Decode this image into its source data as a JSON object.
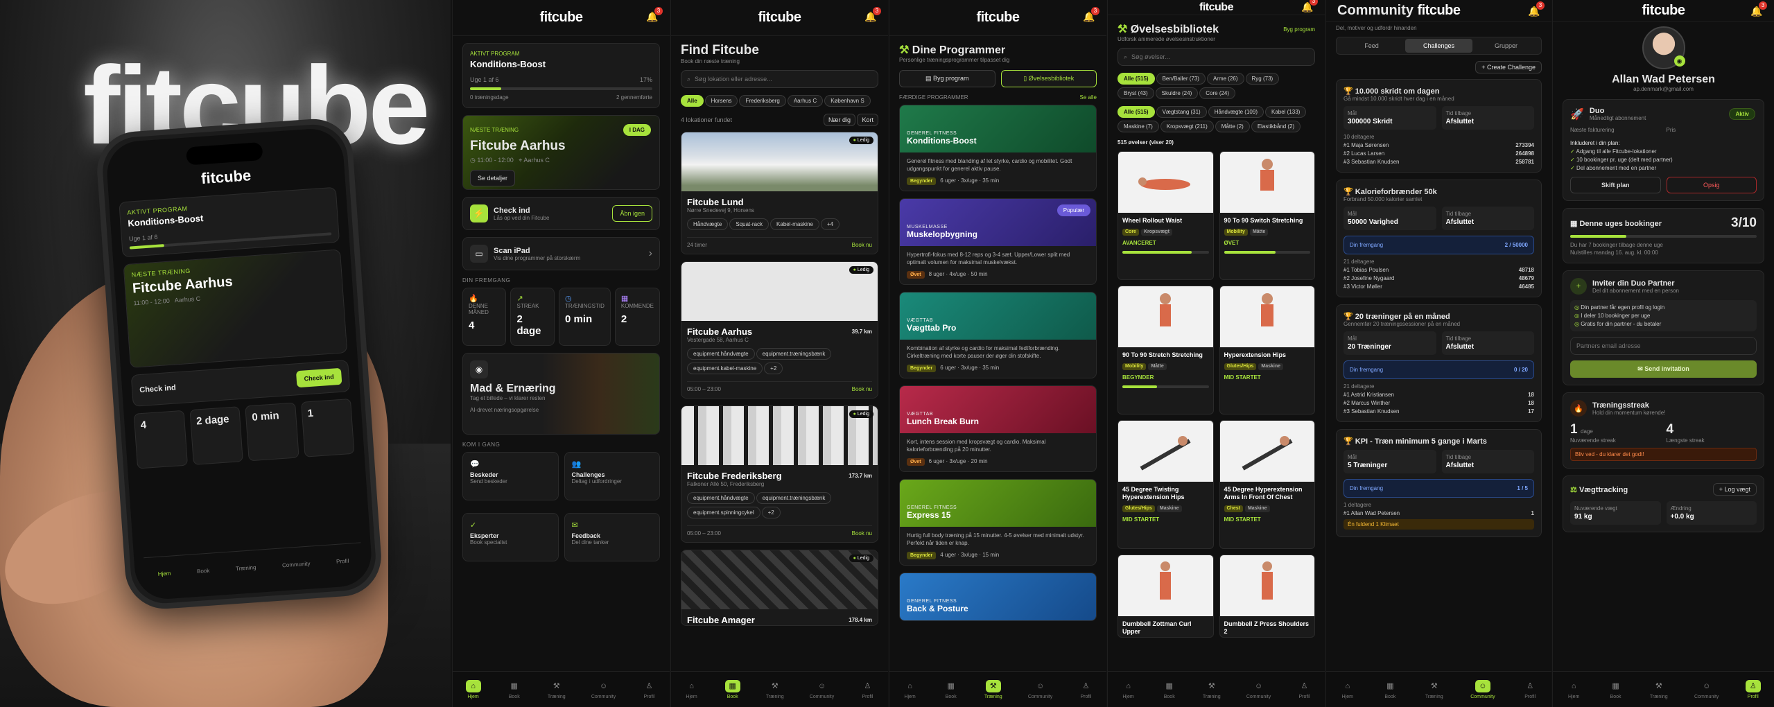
{
  "brand": "fitcube",
  "notif_count": "3",
  "hero": {
    "program_label": "AKTIVT PROGRAM",
    "program_name": "Konditions-Boost",
    "week": "Uge 1 af 6",
    "next_label": "NÆSTE TRÆNING",
    "next_title": "Fitcube Aarhus",
    "next_time": "11:00 - 12:00",
    "next_loc": "Aarhus C",
    "checkin": "Check ind",
    "stats": [
      "4",
      "2 dage",
      "0 min",
      "1"
    ],
    "nav": [
      "Hjem",
      "Book",
      "Træning",
      "Community",
      "Profil"
    ]
  },
  "home": {
    "program_label": "AKTIVT PROGRAM",
    "program_name": "Konditions-Boost",
    "week": "Uge 1 af 6",
    "week_pct": "17%",
    "sessions": "0 træningsdage",
    "sessions_right": "2 gennemførte",
    "next_label": "NÆSTE TRÆNING",
    "today_badge": "I DAG",
    "next_title": "Fitcube Aarhus",
    "next_time": "11:00 - 12:00",
    "next_loc": "Aarhus C",
    "details_btn": "Se detaljer",
    "checkin_title": "Check ind",
    "checkin_sub": "Lås op ved din Fitcube",
    "checkin_btn": "Åbn igen",
    "scan_title": "Scan iPad",
    "scan_sub": "Vis dine programmer på storskærm",
    "progress_header": "DIN FREMGANG",
    "stats": [
      {
        "label": "DENNE MÅNED",
        "value": "4"
      },
      {
        "label": "STREAK",
        "value": "2 dage"
      },
      {
        "label": "TRÆNINGSTID",
        "value": "0 min"
      },
      {
        "label": "KOMMENDE",
        "value": "2"
      }
    ],
    "food_title": "Mad & Ernæring",
    "food_sub": "Tag et billede – vi klarer resten",
    "food_note": "AI-drevet næringsopgørelse",
    "get_started": "KOM I GANG",
    "quick": [
      {
        "title": "Beskeder",
        "sub": "Send beskeder"
      },
      {
        "title": "Challenges",
        "sub": "Deltag i udfordringer"
      },
      {
        "title": "Eksperter",
        "sub": "Book specialist"
      },
      {
        "title": "Feedback",
        "sub": "Del dine tanker"
      }
    ]
  },
  "nav": [
    "Hjem",
    "Book",
    "Træning",
    "Community",
    "Profil"
  ],
  "find": {
    "title": "Find Fitcube",
    "subtitle": "Book din næste træning",
    "search_placeholder": "Søg lokation eller adresse...",
    "filters": [
      "Alle",
      "Horsens",
      "Frederiksberg",
      "Aarhus C",
      "København S"
    ],
    "count": "4 lokationer fundet",
    "near": "Nær dig",
    "map": "Kort",
    "gyms": [
      {
        "name": "Fitcube Lund",
        "addr": "Nørre Snedevej 9, Horsens",
        "tags": [
          "Håndvægte",
          "Squat-rack",
          "Kabel-maskine",
          "+4"
        ],
        "hours": "24 timer",
        "dist": "",
        "status": "Ledig",
        "book": "Book nu"
      },
      {
        "name": "Fitcube Aarhus",
        "addr": "Vestergade 58, Aarhus C",
        "tags": [
          "equipment.håndvægte",
          "equipment.træningsbænk",
          "equipment.kabel-maskine",
          "+2"
        ],
        "hours": "05:00 – 23:00",
        "dist": "39.7 km",
        "status": "Ledig",
        "book": "Book nu"
      },
      {
        "name": "Fitcube Frederiksberg",
        "addr": "Falkoner Allé 50, Frederiksberg",
        "tags": [
          "equipment.håndvægte",
          "equipment.træningsbænk",
          "equipment.spinningcykel",
          "+2"
        ],
        "hours": "05:00 – 23:00",
        "dist": "173.7 km",
        "status": "Ledig",
        "book": "Book nu"
      },
      {
        "name": "Fitcube Amager",
        "addr": "",
        "tags": [],
        "hours": "",
        "dist": "178.4 km",
        "status": "Ledig",
        "book": ""
      }
    ]
  },
  "programs": {
    "title": "Dine Programmer",
    "subtitle": "Personlige træningsprogrammer tilpasset dig",
    "build": "Byg program",
    "library": "Øvelsesbibliotek",
    "featured": "FÆRDIGE PROGRAMMER",
    "see_all": "Se alle",
    "items": [
      {
        "cat": "GENEREL FITNESS",
        "name": "Konditions-Boost",
        "desc": "Generel fitness med blanding af let styrke, cardio og mobilitet. Godt udgangspunkt for generel aktiv pause.",
        "level": "Begynder",
        "weeks": "6 uger",
        "freq": "3x/uge",
        "min": "35 min",
        "popular": ""
      },
      {
        "cat": "MUSKELMASSE",
        "name": "Muskelopbygning",
        "desc": "Hypertrofi-fokus med 8-12 reps og 3-4 sæt. Upper/Lower split med optimalt volumen for maksimal muskelvækst.",
        "level": "Øvet",
        "weeks": "8 uger",
        "freq": "4x/uge",
        "min": "50 min",
        "popular": "Populær"
      },
      {
        "cat": "VÆGTTAB",
        "name": "Vægttab Pro",
        "desc": "Kombination af styrke og cardio for maksimal fedtforbrænding. Cirkeltræning med korte pauser der øger din stofskifte.",
        "level": "Begynder",
        "weeks": "6 uger",
        "freq": "3x/uge",
        "min": "35 min",
        "popular": ""
      },
      {
        "cat": "VÆGTTAB",
        "name": "Lunch Break Burn",
        "desc": "Kort, intens session med kropsvægt og cardio. Maksimal kalorieforbrænding på 20 minutter.",
        "level": "Øvet",
        "weeks": "6 uger",
        "freq": "3x/uge",
        "min": "20 min",
        "popular": ""
      },
      {
        "cat": "GENEREL FITNESS",
        "name": "Express 15",
        "desc": "Hurtig full body træning på 15 minutter. 4-5 øvelser med minimalt udstyr. Perfekt når tiden er knap.",
        "level": "Begynder",
        "weeks": "4 uger",
        "freq": "3x/uge",
        "min": "15 min",
        "popular": ""
      },
      {
        "cat": "GENEREL FITNESS",
        "name": "Back & Posture",
        "desc": "",
        "level": "",
        "weeks": "",
        "freq": "",
        "min": "",
        "popular": ""
      }
    ]
  },
  "library": {
    "title": "Øvelsesbibliotek",
    "subtitle": "Udforsk animerede øvelsesinstruktioner",
    "build": "Byg program",
    "search_placeholder": "Søg øvelser...",
    "muscles": [
      "Alle (515)",
      "Ben/Baller (73)",
      "Arme (26)",
      "Ryg (73)",
      "Bryst (43)",
      "Skuldre (24)",
      "Core (24)"
    ],
    "equipment": [
      "Alle (515)",
      "Vægtstang (31)",
      "Håndvægte (109)",
      "Kabel (133)",
      "Maskine (7)",
      "Kropsvægt (211)",
      "Måtte (2)",
      "Elastikbånd (2)"
    ],
    "count": "515 øvelser (viser 20)",
    "exercises": [
      {
        "name": "Wheel Rollout Waist",
        "tags": [
          "Core",
          "Kropsvægt"
        ],
        "level": "AVANCERET"
      },
      {
        "name": "90 To 90 Switch Stretching",
        "tags": [
          "Mobility",
          "Måtte"
        ],
        "level": "ØVET"
      },
      {
        "name": "90 To 90 Stretch Stretching",
        "tags": [
          "Mobility",
          "Måtte"
        ],
        "level": "BEGYNDER"
      },
      {
        "name": "Hyperextension Hips",
        "tags": [
          "Glutes/Hips",
          "Maskine"
        ],
        "level": "MID STARTET"
      },
      {
        "name": "45 Degree Twisting Hyperextension Hips",
        "tags": [
          "Glutes/Hips",
          "Maskine"
        ],
        "level": "MID STARTET"
      },
      {
        "name": "45 Degree Hyperextension Arms In Front Of Chest",
        "tags": [
          "Chest",
          "Maskine"
        ],
        "level": "MID STARTET"
      },
      {
        "name": "Dumbbell Zottman Curl Upper",
        "tags": [],
        "level": ""
      },
      {
        "name": "Dumbbell Z Press Shoulders 2",
        "tags": [],
        "level": ""
      }
    ]
  },
  "community": {
    "title": "Community",
    "subtitle": "Del, motiver og udfordr hinanden",
    "tabs": [
      "Feed",
      "Challenges",
      "Grupper"
    ],
    "create": "Create Challenge",
    "challenges": [
      {
        "title": "10.000 skridt om dagen",
        "desc": "Gå mindst 10.000 skridt hver dag i en måned",
        "goal_label": "Mål",
        "goal": "300000 Skridt",
        "status_label": "Tid tilbage",
        "status": "Afsluttet",
        "participants": "10 deltagere",
        "progress": "",
        "rows": [
          [
            "#1 Maja Sørensen",
            "273394"
          ],
          [
            "#2 Lucas Larsen",
            "264898"
          ],
          [
            "#3 Sebastian Knudsen",
            "258781"
          ]
        ]
      },
      {
        "title": "Kalorieforbrænder 50k",
        "desc": "Forbrand 50.000 kalorier samlet",
        "goal_label": "Mål",
        "goal": "50000 Varighed",
        "status_label": "Tid tilbage",
        "status": "Afsluttet",
        "participants": "21 deltagere",
        "progress": "2 / 50000",
        "rows": [
          [
            "#1 Tobias Poulsen",
            "48718"
          ],
          [
            "#2 Josefine Nygaard",
            "48679"
          ],
          [
            "#3 Victor Møller",
            "46485"
          ]
        ]
      },
      {
        "title": "20 træninger på en måned",
        "desc": "Gennemfør 20 træningssessioner på en måned",
        "goal_label": "Mål",
        "goal": "20 Træninger",
        "status_label": "Tid tilbage",
        "status": "Afsluttet",
        "participants": "21 deltagere",
        "progress": "0 / 20",
        "rows": [
          [
            "#1 Astrid Kristiansen",
            "18"
          ],
          [
            "#2 Marcus Winther",
            "18"
          ],
          [
            "#3 Sebastian Knudsen",
            "17"
          ]
        ]
      },
      {
        "title": "KPI - Træn minimum 5 gange i Marts",
        "desc": "",
        "goal_label": "Mål",
        "goal": "5 Træninger",
        "status_label": "Tid tilbage",
        "status": "Afsluttet",
        "participants": "1 deltagere",
        "progress": "1 / 5",
        "rows": [
          [
            "#1 Allan Wad Petersen",
            "1"
          ]
        ]
      }
    ],
    "own_result": "Én fuldend 1 Klimaet",
    "your_progress": "Din fremgang"
  },
  "profile": {
    "name": "Allan Wad Petersen",
    "email": "ap.denmark@gmail.com",
    "plan": "Duo",
    "plan_sub": "Månedligt abonnement",
    "plan_status": "Aktiv",
    "next_billing": "Næste fakturering",
    "price": "Pris",
    "included_label": "Inkluderet i din plan:",
    "included": [
      "Adgang til alle Fitcube-lokationer",
      "10 bookinger pr. uge (delt med partner)",
      "Del abonnement med en partner"
    ],
    "change_plan": "Skift plan",
    "cancel": "Opsig",
    "week_bookings": "Denne uges bookinger",
    "week_bookings_value": "3/10",
    "week_left": "Du har 7 bookinger tilbage denne uge",
    "week_reset": "Nulstilles mandag 16. aug. kl. 00:00",
    "invite_title": "Inviter din Duo Partner",
    "invite_sub": "Del dit abonnement med en person",
    "invite_list": [
      "Din partner får egen profil og login",
      "I deler 10 bookinger per uge",
      "Gratis for din partner - du betaler"
    ],
    "invite_placeholder": "Partners email adresse",
    "invite_btn": "Send invitation",
    "streak_title": "Træningsstreak",
    "streak_sub": "Hold din momentum kørende!",
    "streak_current": "1",
    "streak_current_unit": "dage",
    "streak_current_label": "Nuværende streak",
    "streak_best": "4",
    "streak_best_label": "Længste streak",
    "streak_warn": "Bliv ved - du klarer det godt!",
    "weight_title": "Vægttracking",
    "weight_log": "Log vægt",
    "weight_now_label": "Nuværende vægt",
    "weight_now": "91",
    "weight_unit": "kg",
    "weight_change_label": "Ændring",
    "weight_change": "+0.0"
  }
}
